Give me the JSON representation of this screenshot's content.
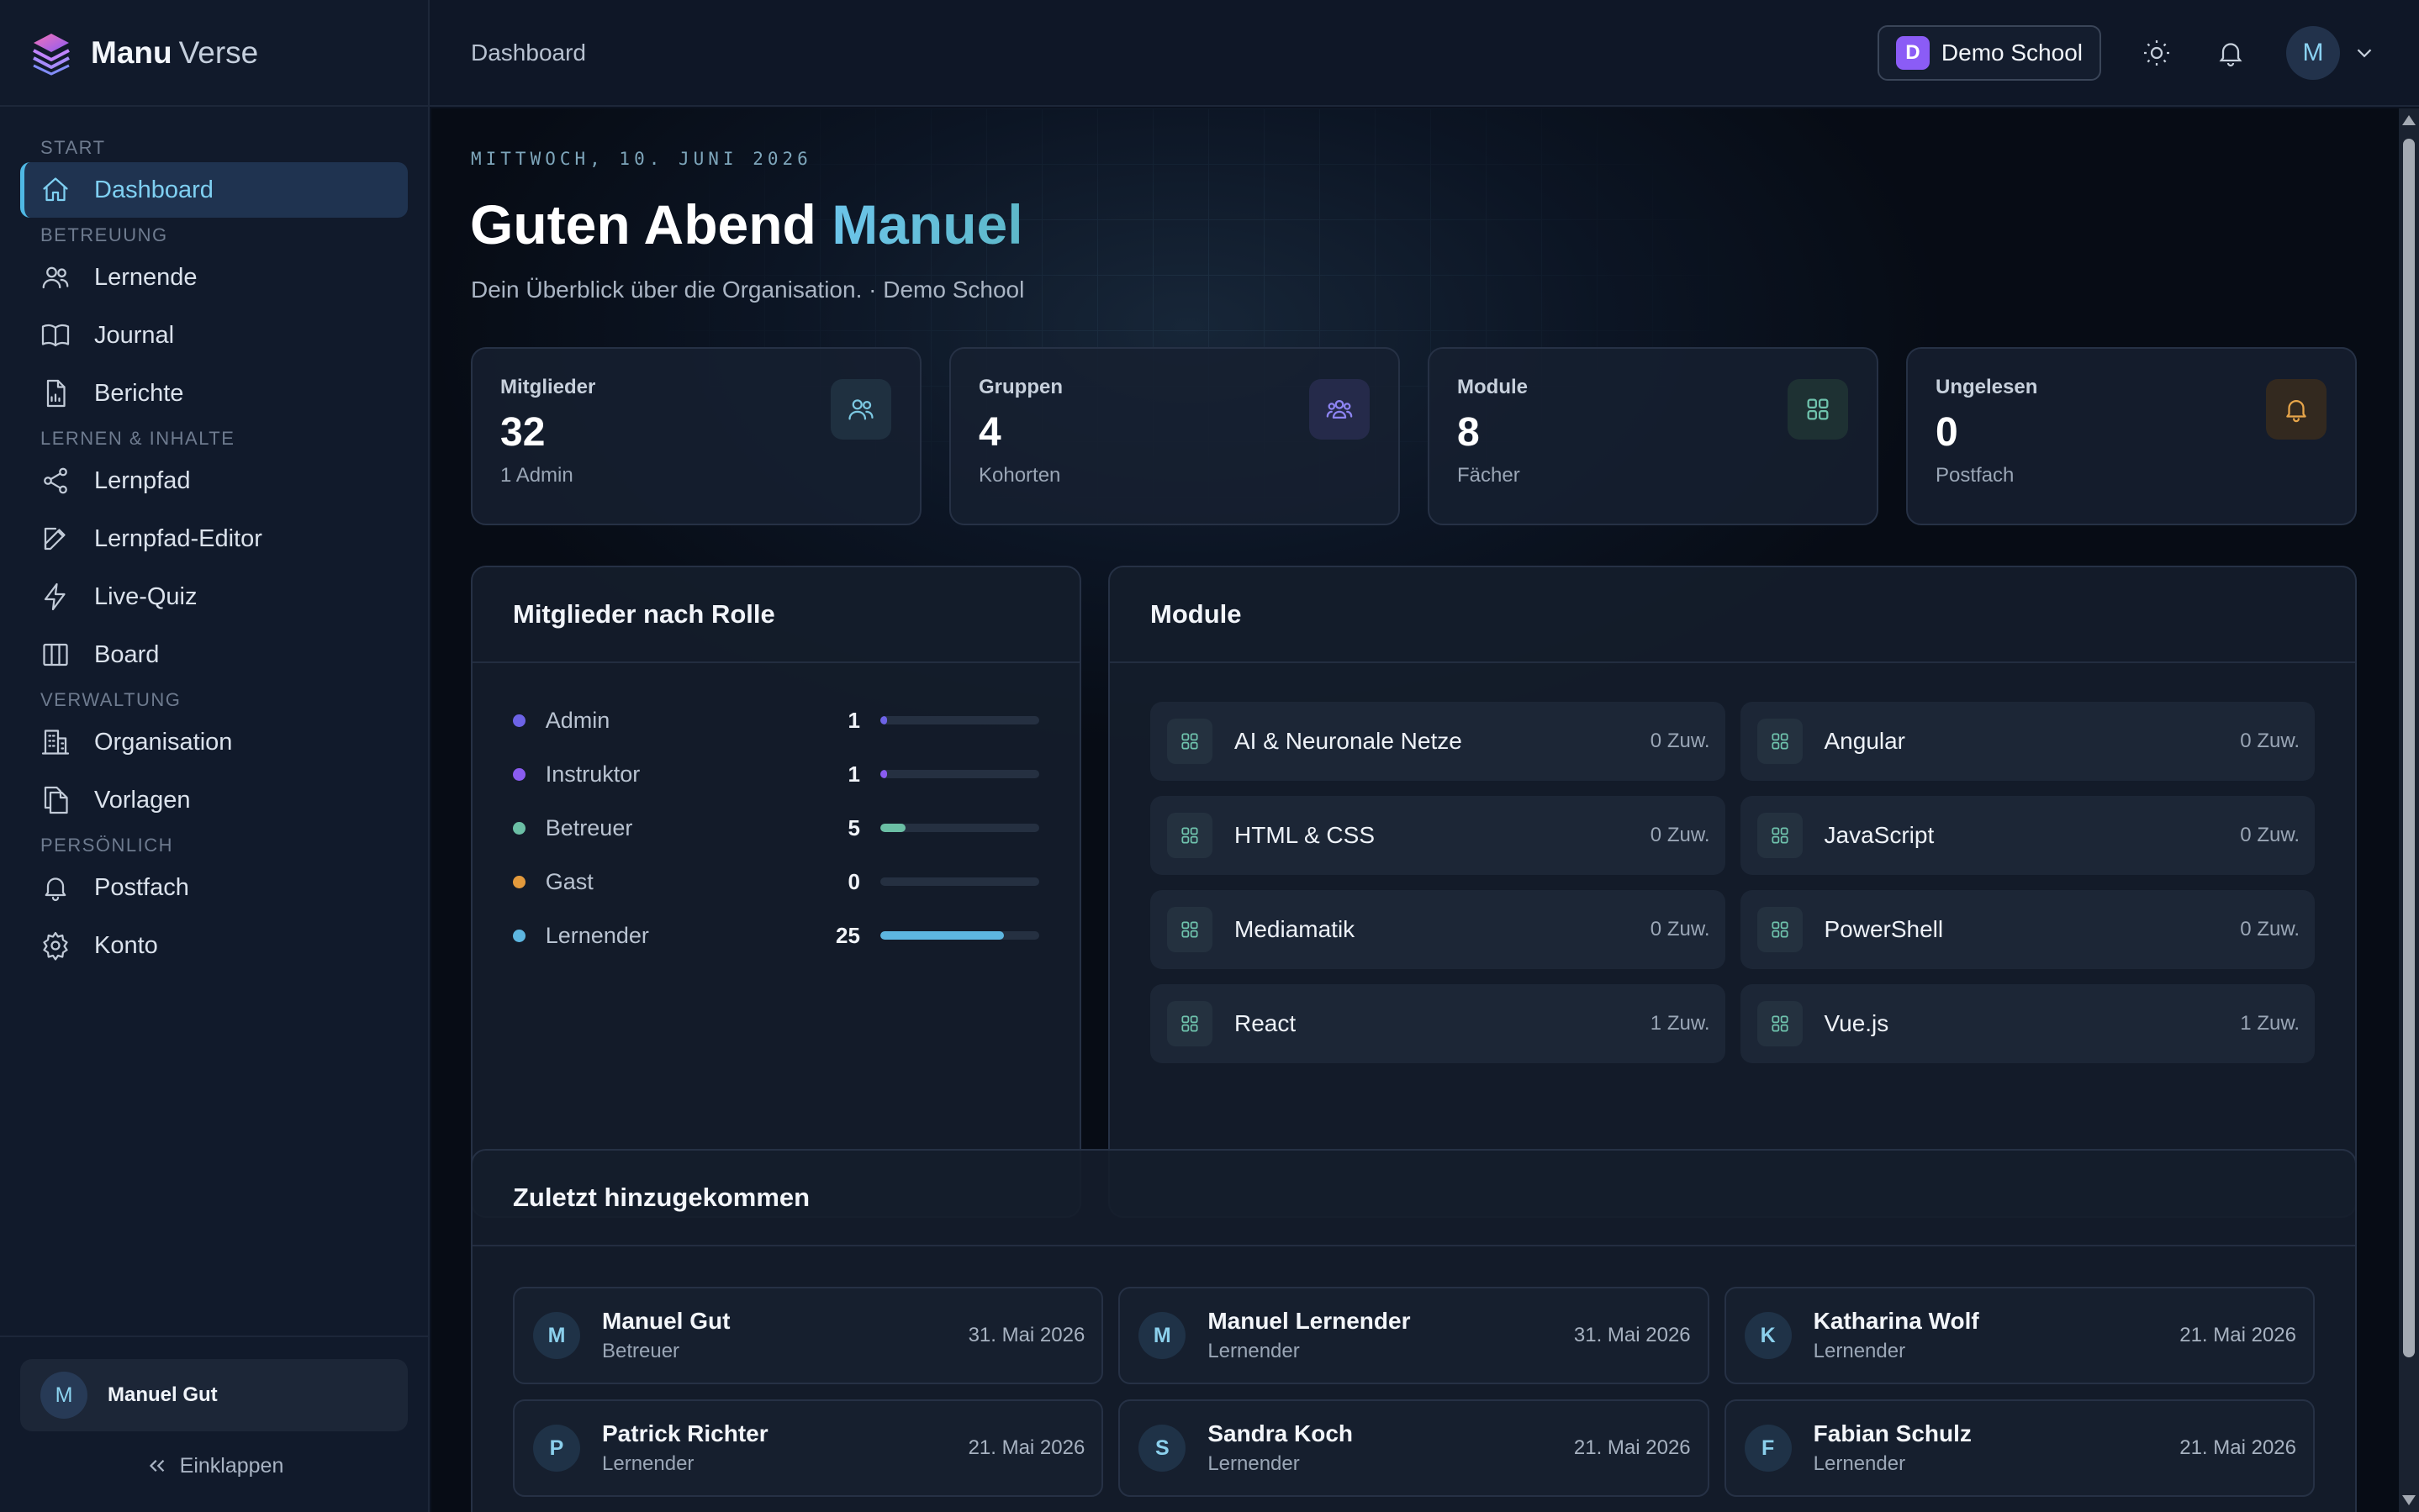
{
  "brand": {
    "name_bold": "Manu",
    "name_light": "Verse"
  },
  "sidebar": {
    "sections": [
      {
        "title": "START",
        "items": [
          {
            "label": "Dashboard",
            "icon": "home-icon",
            "active": true
          }
        ]
      },
      {
        "title": "BETREUUNG",
        "items": [
          {
            "label": "Lernende",
            "icon": "users-icon"
          },
          {
            "label": "Journal",
            "icon": "book-icon"
          },
          {
            "label": "Berichte",
            "icon": "report-icon"
          }
        ]
      },
      {
        "title": "LERNEN & INHALTE",
        "items": [
          {
            "label": "Lernpfad",
            "icon": "share-icon"
          },
          {
            "label": "Lernpfad-Editor",
            "icon": "edit-icon"
          },
          {
            "label": "Live-Quiz",
            "icon": "bolt-icon"
          },
          {
            "label": "Board",
            "icon": "columns-icon"
          }
        ]
      },
      {
        "title": "VERWALTUNG",
        "items": [
          {
            "label": "Organisation",
            "icon": "building-icon"
          },
          {
            "label": "Vorlagen",
            "icon": "copy-icon"
          }
        ]
      },
      {
        "title": "PERSÖNLICH",
        "items": [
          {
            "label": "Postfach",
            "icon": "bell-icon"
          },
          {
            "label": "Konto",
            "icon": "gear-icon"
          }
        ]
      }
    ],
    "user": {
      "initial": "M",
      "name": "Manuel Gut"
    },
    "collapse_label": "Einklappen"
  },
  "topbar": {
    "breadcrumb": "Dashboard",
    "school_initial": "D",
    "school_name": "Demo School",
    "user_initial": "M"
  },
  "hero": {
    "date": "MITTWOCH, 10. JUNI 2026",
    "greeting": "Guten Abend",
    "name": "Manuel",
    "subtitle": "Dein Überblick über die Organisation. · Demo School"
  },
  "stats": [
    {
      "label": "Mitglieder",
      "value": "32",
      "hint": "1 Admin",
      "icon": "users-icon",
      "color": "#7cc8e2",
      "bg": "#1f3040"
    },
    {
      "label": "Gruppen",
      "value": "4",
      "hint": "Kohorten",
      "icon": "group-icon",
      "color": "#8d84f2",
      "bg": "#252a4a"
    },
    {
      "label": "Module",
      "value": "8",
      "hint": "Fächer",
      "icon": "grid-icon",
      "color": "#6fc3ad",
      "bg": "#1e3133"
    },
    {
      "label": "Ungelesen",
      "value": "0",
      "hint": "Postfach",
      "icon": "bell-icon",
      "color": "#e7a54a",
      "bg": "#33291f"
    }
  ],
  "roles_panel": {
    "title": "Mitglieder nach Rolle",
    "roles": [
      {
        "name": "Admin",
        "count": "1",
        "fraction": 0.04,
        "color": "#6d63e6"
      },
      {
        "name": "Instruktor",
        "count": "1",
        "fraction": 0.04,
        "color": "#8a5cf0"
      },
      {
        "name": "Betreuer",
        "count": "5",
        "fraction": 0.16,
        "color": "#6bbfa5"
      },
      {
        "name": "Gast",
        "count": "0",
        "fraction": 0,
        "color": "#e39a3c"
      },
      {
        "name": "Lernender",
        "count": "25",
        "fraction": 0.78,
        "color": "#5db6e0"
      }
    ]
  },
  "modules_panel": {
    "title": "Module",
    "modules": [
      {
        "name": "AI & Neuronale Netze",
        "meta": "0 Zuw."
      },
      {
        "name": "Angular",
        "meta": "0 Zuw."
      },
      {
        "name": "HTML & CSS",
        "meta": "0 Zuw."
      },
      {
        "name": "JavaScript",
        "meta": "0 Zuw."
      },
      {
        "name": "Mediamatik",
        "meta": "0 Zuw."
      },
      {
        "name": "PowerShell",
        "meta": "0 Zuw."
      },
      {
        "name": "React",
        "meta": "1 Zuw."
      },
      {
        "name": "Vue.js",
        "meta": "1 Zuw."
      }
    ]
  },
  "recent_panel": {
    "title": "Zuletzt hinzugekommen",
    "people": [
      {
        "initial": "M",
        "name": "Manuel Gut",
        "role": "Betreuer",
        "date": "31. Mai 2026"
      },
      {
        "initial": "M",
        "name": "Manuel Lernender",
        "role": "Lernender",
        "date": "31. Mai 2026"
      },
      {
        "initial": "K",
        "name": "Katharina Wolf",
        "role": "Lernender",
        "date": "21. Mai 2026"
      },
      {
        "initial": "P",
        "name": "Patrick Richter",
        "role": "Lernender",
        "date": "21. Mai 2026"
      },
      {
        "initial": "S",
        "name": "Sandra Koch",
        "role": "Lernender",
        "date": "21. Mai 2026"
      },
      {
        "initial": "F",
        "name": "Fabian Schulz",
        "role": "Lernender",
        "date": "21. Mai 2026"
      }
    ]
  },
  "colors": {
    "accent": "#4fb8e4",
    "background": "#0b1220"
  }
}
